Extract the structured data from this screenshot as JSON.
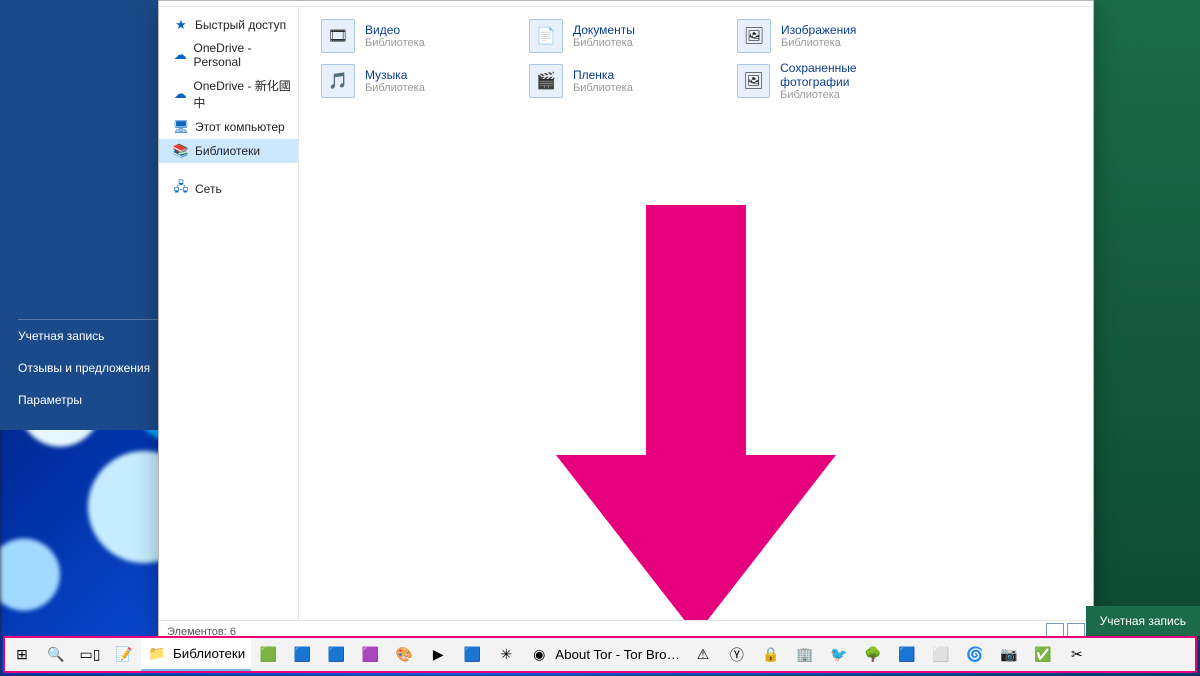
{
  "start_menu": {
    "items": [
      "Учетная запись",
      "Отзывы и предложения",
      "Параметры"
    ]
  },
  "explorer": {
    "nav": [
      {
        "icon": "★",
        "label": "Быстрый доступ",
        "cls": "quick"
      },
      {
        "icon": "☁",
        "label": "OneDrive - Personal",
        "cls": "od"
      },
      {
        "icon": "☁",
        "label": "OneDrive - 新化國中",
        "cls": "od"
      },
      {
        "icon": "🖥",
        "label": "Этот компьютер",
        "cls": "pc"
      },
      {
        "icon": "📚",
        "label": "Библиотеки",
        "cls": "lib",
        "selected": true
      },
      {
        "icon": "🖧",
        "label": "Сеть",
        "cls": "net",
        "gapBefore": true
      }
    ],
    "libraries": [
      {
        "icon": "🎞",
        "name": "Видео",
        "sub": "Библиотека"
      },
      {
        "icon": "📄",
        "name": "Документы",
        "sub": "Библиотека"
      },
      {
        "icon": "🖼",
        "name": "Изображения",
        "sub": "Библиотека"
      },
      {
        "icon": "🎵",
        "name": "Музыка",
        "sub": "Библиотека"
      },
      {
        "icon": "🎬",
        "name": "Пленка",
        "sub": "Библиотека"
      },
      {
        "icon": "🖼",
        "name": "Сохраненные фотографии",
        "sub": "Библиотека"
      }
    ],
    "status": "Элементов: 6"
  },
  "annotation": {
    "arrow_color": "#e6007e"
  },
  "account_tile": "Учетная запись",
  "taskbar": {
    "buttons": [
      {
        "name": "start-button",
        "icon": "⊞"
      },
      {
        "name": "search-button",
        "icon": "🔍"
      },
      {
        "name": "taskview-button",
        "icon": "▭▯"
      },
      {
        "name": "sticky-notes",
        "icon": "📝"
      },
      {
        "name": "explorer",
        "icon": "📁",
        "label": "Библиотеки",
        "active": true
      },
      {
        "name": "app-green",
        "icon": "🟩"
      },
      {
        "name": "app-word",
        "icon": "🟦"
      },
      {
        "name": "app-teal",
        "icon": "🟦"
      },
      {
        "name": "app-purple",
        "icon": "🟪"
      },
      {
        "name": "app-orange",
        "icon": "🎨"
      },
      {
        "name": "media-player",
        "icon": "▶"
      },
      {
        "name": "app-blue2",
        "icon": "🟦"
      },
      {
        "name": "app-dark",
        "icon": "✳"
      },
      {
        "name": "tor-browser",
        "icon": "◉",
        "label": "About Tor - Tor Bro…"
      },
      {
        "name": "warning",
        "icon": "⚠"
      },
      {
        "name": "yandex",
        "icon": "Ⓨ"
      },
      {
        "name": "lock-app",
        "icon": "🔒"
      },
      {
        "name": "app-cyan",
        "icon": "🏢"
      },
      {
        "name": "colibri",
        "icon": "🐦"
      },
      {
        "name": "tree",
        "icon": "🌳"
      },
      {
        "name": "app-d",
        "icon": "🟦"
      },
      {
        "name": "app-white",
        "icon": "⬜"
      },
      {
        "name": "app-swoosh",
        "icon": "🌀"
      },
      {
        "name": "instagram",
        "icon": "📷"
      },
      {
        "name": "todo",
        "icon": "✅"
      },
      {
        "name": "snip",
        "icon": "✂"
      }
    ]
  }
}
